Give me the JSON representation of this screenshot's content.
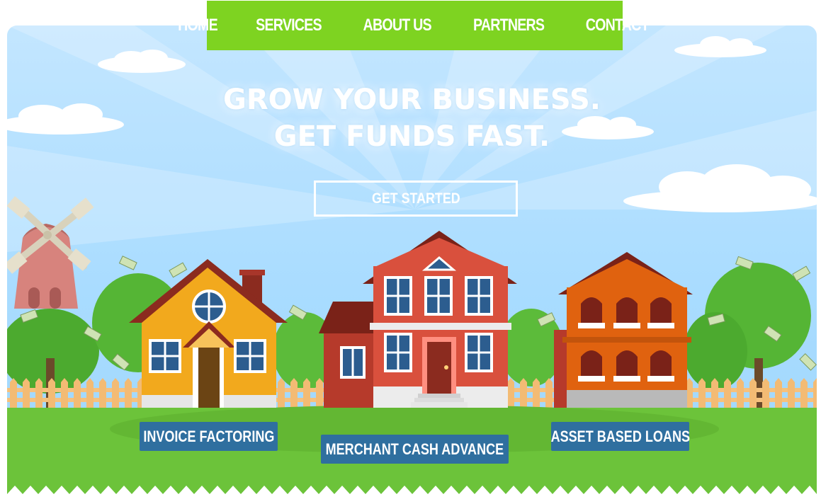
{
  "nav": {
    "items": [
      {
        "label": "HOME"
      },
      {
        "label": "SERVICES"
      },
      {
        "label": "ABOUT US"
      },
      {
        "label": "PARTNERS"
      },
      {
        "label": "CONTACT"
      }
    ]
  },
  "hero": {
    "line1": "GROW YOUR BUSINESS.",
    "line2": "GET FUNDS FAST.",
    "cta_label": "GET STARTED"
  },
  "services": {
    "invoice": "INVOICE FACTORING",
    "merchant": "MERCHANT CASH ADVANCE",
    "asset": "ASSET BASED LOANS"
  },
  "colors": {
    "nav_green": "#7ed321",
    "sky": "#a9dcff",
    "grass": "#6cc33a",
    "pill_blue": "#2f6f9f"
  }
}
